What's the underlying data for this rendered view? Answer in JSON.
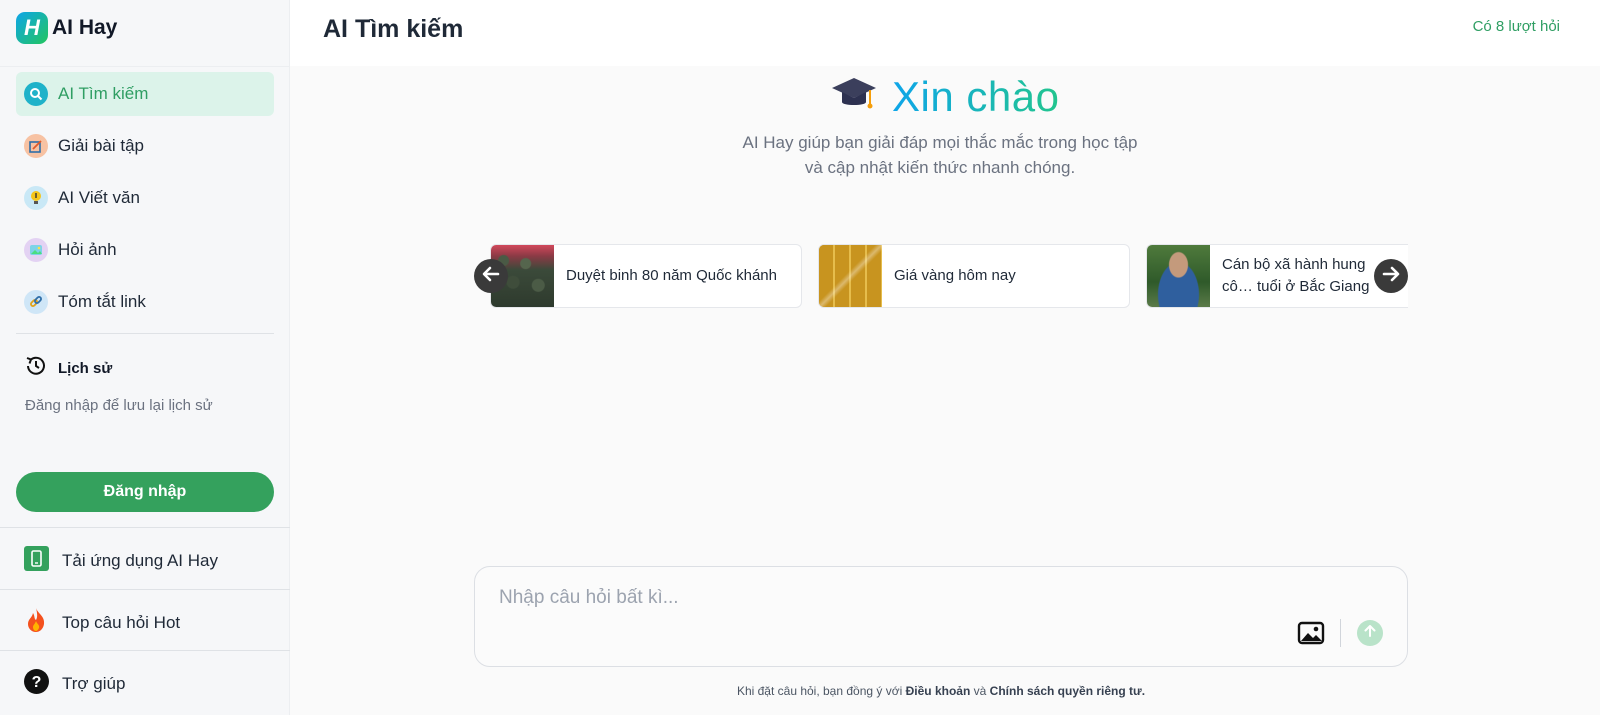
{
  "brand": {
    "name": "AI Hay",
    "mark": "H"
  },
  "header": {
    "title": "AI Tìm kiếm",
    "quota": "Có 8 lượt hỏi"
  },
  "sidebar": {
    "nav": [
      {
        "label": "AI Tìm kiếm",
        "icon": "search-icon",
        "active": true
      },
      {
        "label": "Giải bài tập",
        "icon": "homework-icon",
        "active": false
      },
      {
        "label": "AI Viết văn",
        "icon": "lightbulb-icon",
        "active": false
      },
      {
        "label": "Hỏi ảnh",
        "icon": "image-icon",
        "active": false
      },
      {
        "label": "Tóm tắt link",
        "icon": "link-icon",
        "active": false
      }
    ],
    "history_title": "Lịch sử",
    "history_hint": "Đăng nhập để lưu lại lịch sử",
    "login_label": "Đăng nhập",
    "bottom": [
      {
        "label": "Tải ứng dụng AI Hay",
        "icon": "phone-icon"
      },
      {
        "label": "Top câu hỏi Hot",
        "icon": "fire-icon"
      },
      {
        "label": "Trợ giúp",
        "icon": "help-icon"
      }
    ]
  },
  "greeting": {
    "title": "Xin chào",
    "subtitle": "AI Hay giúp bạn giải đáp mọi thắc mắc trong học tập và cập nhật kiến thức nhanh chóng."
  },
  "suggestions": [
    {
      "text": "Duyệt binh 80 năm Quốc khánh",
      "thumb": "soldiers-thumbnail"
    },
    {
      "text": "Giá vàng hôm nay",
      "thumb": "gold-bars-thumbnail"
    },
    {
      "text": "Cán bộ xã hành hung cô… tuổi ở Bắc Giang",
      "thumb": "portrait-thumbnail"
    }
  ],
  "input": {
    "placeholder": "Nhập câu hỏi bất kì...",
    "value": ""
  },
  "legal": {
    "prefix": "Khi đặt câu hỏi, bạn đồng ý với",
    "terms": "Điều khoản",
    "and": "và",
    "privacy": "Chính sách quyền riêng tư."
  },
  "colors": {
    "accent": "#34a15d",
    "active_bg": "#dcf3ea",
    "active_text": "#2f9e63"
  }
}
